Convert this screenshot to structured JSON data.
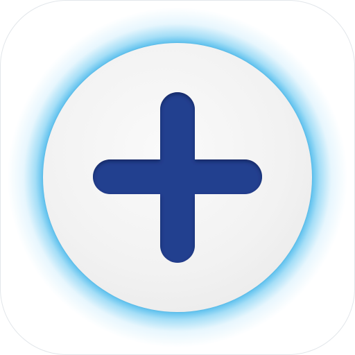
{
  "app_icon": {
    "name": "plus-app-icon",
    "icon": "plus-icon",
    "colors": {
      "tile_background": "#ffffff",
      "glow": "#2dade8",
      "disc": "#f2f2f2",
      "plus": "#233f8f",
      "plus_shadow": "#142a66"
    }
  }
}
